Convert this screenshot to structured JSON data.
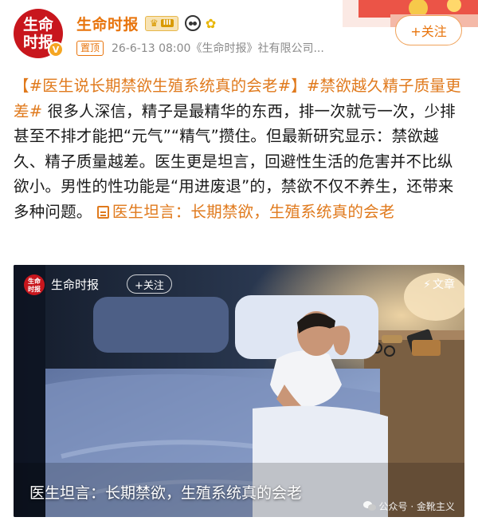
{
  "header": {
    "avatar_line1": "生命",
    "avatar_line2": "时报",
    "verified_mark": "V",
    "account_name": "生命时报",
    "vip_level": "III",
    "pin_label": "置顶",
    "meta": "26-6-13 08:00《生命时报》社有限公司...",
    "follow_label": "+关注"
  },
  "post": {
    "tag1": "【#医生说长期禁欲生殖系统真的会老#】",
    "tag2": "#禁欲越久精子质量更差#",
    "body": " 很多人深信，精子是最精华的东西，排一次就亏一次，少排甚至不排才能把“元气”“精气”攒住。但最新研究显示：禁欲越久、精子质量越差。医生更是坦言，回避性生活的危害并不比纵欲小。男性的性功能是“用进废退”的，禁欲不仅不养生，还带来多种问题。",
    "link_text": "医生坦言：长期禁欲，生殖系统真的会老"
  },
  "video": {
    "avatar_line1": "生命",
    "avatar_line2": "时报",
    "channel_name": "生命时报",
    "follow_label": "+关注",
    "article_label": "文章",
    "caption": "医生坦言：长期禁欲，生殖系统真的会老",
    "watermark": "公众号 · 金靴主义"
  },
  "colors": {
    "accent": "#e8740c",
    "tag": "#e07a1d",
    "brand_red": "#c8161d"
  },
  "icons": [
    "verified-icon",
    "crown-icon",
    "panda-emoji-icon",
    "flower-emoji-icon",
    "link-icon",
    "bolt-icon",
    "wechat-icon"
  ]
}
